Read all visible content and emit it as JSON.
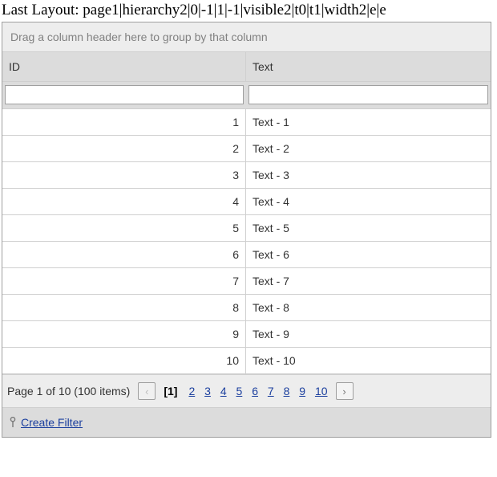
{
  "heading": "Last Layout: page1|hierarchy2|0|-1|1|-1|visible2|t0|t1|width2|e|e",
  "groupPanel": "Drag a column header here to group by that column",
  "columns": {
    "id": "ID",
    "text": "Text"
  },
  "filters": {
    "id": "",
    "text": ""
  },
  "rows": [
    {
      "id": "1",
      "text": "Text - 1"
    },
    {
      "id": "2",
      "text": "Text - 2"
    },
    {
      "id": "3",
      "text": "Text - 3"
    },
    {
      "id": "4",
      "text": "Text - 4"
    },
    {
      "id": "5",
      "text": "Text - 5"
    },
    {
      "id": "6",
      "text": "Text - 6"
    },
    {
      "id": "7",
      "text": "Text - 7"
    },
    {
      "id": "8",
      "text": "Text - 8"
    },
    {
      "id": "9",
      "text": "Text - 9"
    },
    {
      "id": "10",
      "text": "Text - 10"
    }
  ],
  "pager": {
    "summary": "Page 1 of 10 (100 items)",
    "prevGlyph": "‹",
    "nextGlyph": "›",
    "currentLabel": "[1]",
    "pages": [
      "2",
      "3",
      "4",
      "5",
      "6",
      "7",
      "8",
      "9",
      "10"
    ]
  },
  "filterBar": {
    "link": "Create Filter"
  }
}
